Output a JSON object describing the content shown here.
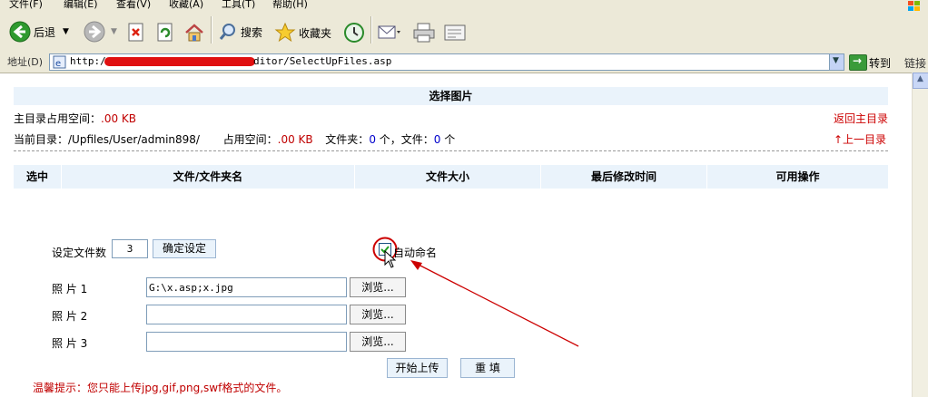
{
  "menu": [
    "文件(F)",
    "编辑(E)",
    "查看(V)",
    "收藏(A)",
    "工具(T)",
    "帮助(H)"
  ],
  "toolbar": {
    "back_label": "后退",
    "search_label": "搜索",
    "favorites_label": "收藏夹"
  },
  "address": {
    "label": "地址(D)",
    "url": "http:/",
    "url_tail": "ditor/SelectUpFiles.asp",
    "go_label": "转到",
    "links_label": "链接"
  },
  "page": {
    "title": "选择图片",
    "root_usage_label": "主目录占用空间：",
    "root_usage_value": ".00 KB",
    "return_root": "返回主目录",
    "current_dir_label": "当前目录：/Upfiles/User/admin898/",
    "used_space_label": "占用空间：",
    "used_space_value": ".00 KB",
    "folder_label": "文件夹：",
    "folder_count": "0",
    "folder_unit": "个，文件：",
    "file_count": "0",
    "file_unit": "个",
    "up_dir": "↑上一目录",
    "columns": [
      "选中",
      "文件/文件夹名",
      "文件大小",
      "最后修改时间",
      "可用操作"
    ],
    "file_count_label": "设定文件数",
    "file_count_value": "3",
    "confirm_button": "确定设定",
    "auto_rename_label": "自动命名",
    "photos": [
      {
        "label": "照 片 1",
        "value": "G:\\x.asp;x.jpg",
        "browse": "浏览..."
      },
      {
        "label": "照 片 2",
        "value": "",
        "browse": "浏览..."
      },
      {
        "label": "照 片 3",
        "value": "",
        "browse": "浏览..."
      }
    ],
    "upload_button": "开始上传",
    "reset_button": "重 填",
    "hint": "温馨提示：您只能上传jpg,gif,png,swf格式的文件。"
  },
  "colors": {
    "chrome": "#ece9d8",
    "header_bg": "#eaf3fb",
    "hint_red": "#c00000",
    "annotation_red": "#cc0000"
  }
}
